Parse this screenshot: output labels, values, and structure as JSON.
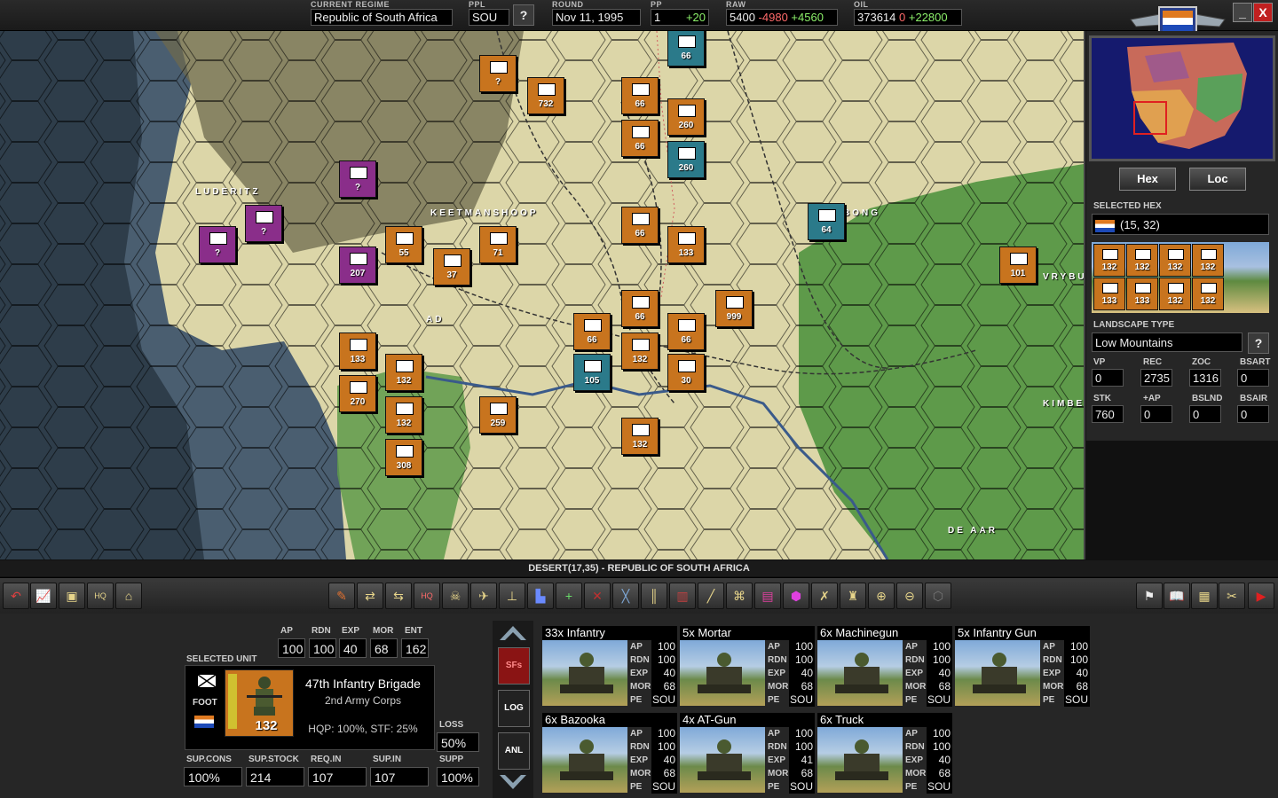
{
  "top_bar": {
    "regime_label": "CURRENT REGIME",
    "regime_value": "Republic of South Africa",
    "ppl_label": "PPL",
    "ppl_value": "SOU",
    "help_button": "?",
    "round_label": "ROUND",
    "round_value": "Nov 11, 1995",
    "pp_label": "PP",
    "pp_value": "1",
    "pp_income": "+20",
    "raw_label": "RAW",
    "raw_value": "5400",
    "raw_minus": "-4980",
    "raw_plus": "+4560",
    "oil_label": "OIL",
    "oil_value": "373614",
    "oil_minus": "0",
    "oil_plus": "+22800",
    "minimize_icon": "_",
    "close_icon": "X"
  },
  "map": {
    "place_names": [
      "LUDERITZ",
      "KEETMANSHOOP",
      "BONG",
      "VRYBU",
      "KIMBE",
      "DE AAR",
      "AD"
    ],
    "units": [
      {
        "value": "?",
        "color": "#c8741e"
      },
      {
        "value": "732",
        "color": "#c8741e"
      },
      {
        "value": "66",
        "color": "#2b7a8a"
      },
      {
        "value": "66",
        "color": "#c8741e"
      },
      {
        "value": "66",
        "color": "#c8741e"
      },
      {
        "value": "260",
        "color": "#c8741e"
      },
      {
        "value": "260",
        "color": "#2b7a8a"
      },
      {
        "value": "?",
        "color": "#8a2e8a"
      },
      {
        "value": "?",
        "color": "#8a2e8a"
      },
      {
        "value": "?",
        "color": "#8a2e8a"
      },
      {
        "value": "66",
        "color": "#c8741e"
      },
      {
        "value": "64",
        "color": "#2b7a8a"
      },
      {
        "value": "207",
        "color": "#8a2e8a"
      },
      {
        "value": "55",
        "color": "#c8741e"
      },
      {
        "value": "71",
        "color": "#c8741e"
      },
      {
        "value": "37",
        "color": "#c8741e"
      },
      {
        "value": "133",
        "color": "#c8741e"
      },
      {
        "value": "101",
        "color": "#c8741e"
      },
      {
        "value": "999",
        "color": "#c8741e"
      },
      {
        "value": "66",
        "color": "#c8741e"
      },
      {
        "value": "66",
        "color": "#c8741e"
      },
      {
        "value": "66",
        "color": "#c8741e"
      },
      {
        "value": "133",
        "color": "#c8741e"
      },
      {
        "value": "132",
        "color": "#c8741e"
      },
      {
        "value": "132",
        "color": "#c8741e"
      },
      {
        "value": "105",
        "color": "#2b7a8a"
      },
      {
        "value": "30",
        "color": "#c8741e"
      },
      {
        "value": "270",
        "color": "#c8741e"
      },
      {
        "value": "132",
        "color": "#c8741e"
      },
      {
        "value": "259",
        "color": "#c8741e"
      },
      {
        "value": "132",
        "color": "#c8741e"
      },
      {
        "value": "308",
        "color": "#c8741e"
      },
      {
        "value": "999",
        "color": "#c8741e"
      }
    ]
  },
  "status_bar": "DESERT(17,35) - REPUBLIC OF SOUTH AFRICA",
  "side_panel": {
    "hex_button": "Hex",
    "loc_button": "Loc",
    "selected_hex_label": "SELECTED HEX",
    "selected_hex_value": "(15, 32)",
    "hex_units": [
      "132",
      "132",
      "132",
      "132",
      "133",
      "133",
      "132",
      "132"
    ],
    "landscape_label": "LANDSCAPE TYPE",
    "landscape_value": "Low Mountains",
    "landscape_help": "?",
    "vp_label": "VP",
    "vp_value": "0",
    "rec_label": "REC",
    "rec_value": "2735",
    "zoc_label": "ZOC",
    "zoc_value": "1316",
    "bsart_label": "BSART",
    "bsart_value": "0",
    "stk_label": "STK",
    "stk_value": "760",
    "ap_label": "+AP",
    "ap_value": "0",
    "bslnd_label": "BSLND",
    "bslnd_value": "0",
    "bsair_label": "BSAIR",
    "bsair_value": "0"
  },
  "selected_unit": {
    "section_label": "SELECTED UNIT",
    "ap_label": "AP",
    "ap_value": "100",
    "rdn_label": "RDN",
    "rdn_value": "100",
    "exp_label": "EXP",
    "exp_value": "40",
    "mor_label": "MOR",
    "mor_value": "68",
    "ent_label": "ENT",
    "ent_value": "162",
    "type_label": "FOOT",
    "unit_strength": "132",
    "name": "47th Infantry Brigade",
    "corps": "2nd Army Corps",
    "hqp_stf": "HQP: 100%, STF: 25%",
    "loss_label": "LOSS",
    "loss_value": "50%",
    "supp_label": "SUPP",
    "supp_value": "100%",
    "supcons_label": "SUP.CONS",
    "supcons_value": "100%",
    "supstock_label": "SUP.STOCK",
    "supstock_value": "214",
    "reqin_label": "REQ.IN",
    "reqin_value": "107",
    "supin_label": "SUP.IN",
    "supin_value": "107"
  },
  "side_buttons": {
    "sfs": "SFs",
    "log": "LOG",
    "anl": "ANL"
  },
  "subformations": [
    {
      "name": "33x Infantry",
      "ap": "100",
      "rdn": "100",
      "exp": "40",
      "mor": "68",
      "pe": "SOU",
      "icon": "infantry"
    },
    {
      "name": "5x Mortar",
      "ap": "100",
      "rdn": "100",
      "exp": "40",
      "mor": "68",
      "pe": "SOU",
      "icon": "mortar"
    },
    {
      "name": "6x Machinegun",
      "ap": "100",
      "rdn": "100",
      "exp": "40",
      "mor": "68",
      "pe": "SOU",
      "icon": "machinegun"
    },
    {
      "name": "5x Infantry Gun",
      "ap": "100",
      "rdn": "100",
      "exp": "40",
      "mor": "68",
      "pe": "SOU",
      "icon": "infantry-gun"
    },
    {
      "name": "6x Bazooka",
      "ap": "100",
      "rdn": "100",
      "exp": "40",
      "mor": "68",
      "pe": "SOU",
      "icon": "bazooka"
    },
    {
      "name": "4x AT-Gun",
      "ap": "100",
      "rdn": "100",
      "exp": "41",
      "mor": "68",
      "pe": "SOU",
      "icon": "at-gun"
    },
    {
      "name": "6x Truck",
      "ap": "100",
      "rdn": "100",
      "exp": "40",
      "mor": "68",
      "pe": "SOU",
      "icon": "truck"
    }
  ],
  "stat_keys": {
    "ap": "AP",
    "rdn": "RDN",
    "exp": "EXP",
    "mor": "MOR",
    "pe": "PE"
  },
  "colors": {
    "desert": "#dcd6a8",
    "ocean": "#4a5e70",
    "deep_ocean": "#2e3d4a",
    "grass": "#5e9a4a",
    "friendly_highlight": "#3cff3c",
    "orange_unit": "#c8741e",
    "purple_unit": "#8a2e8a",
    "teal_unit": "#2b7a8a"
  }
}
